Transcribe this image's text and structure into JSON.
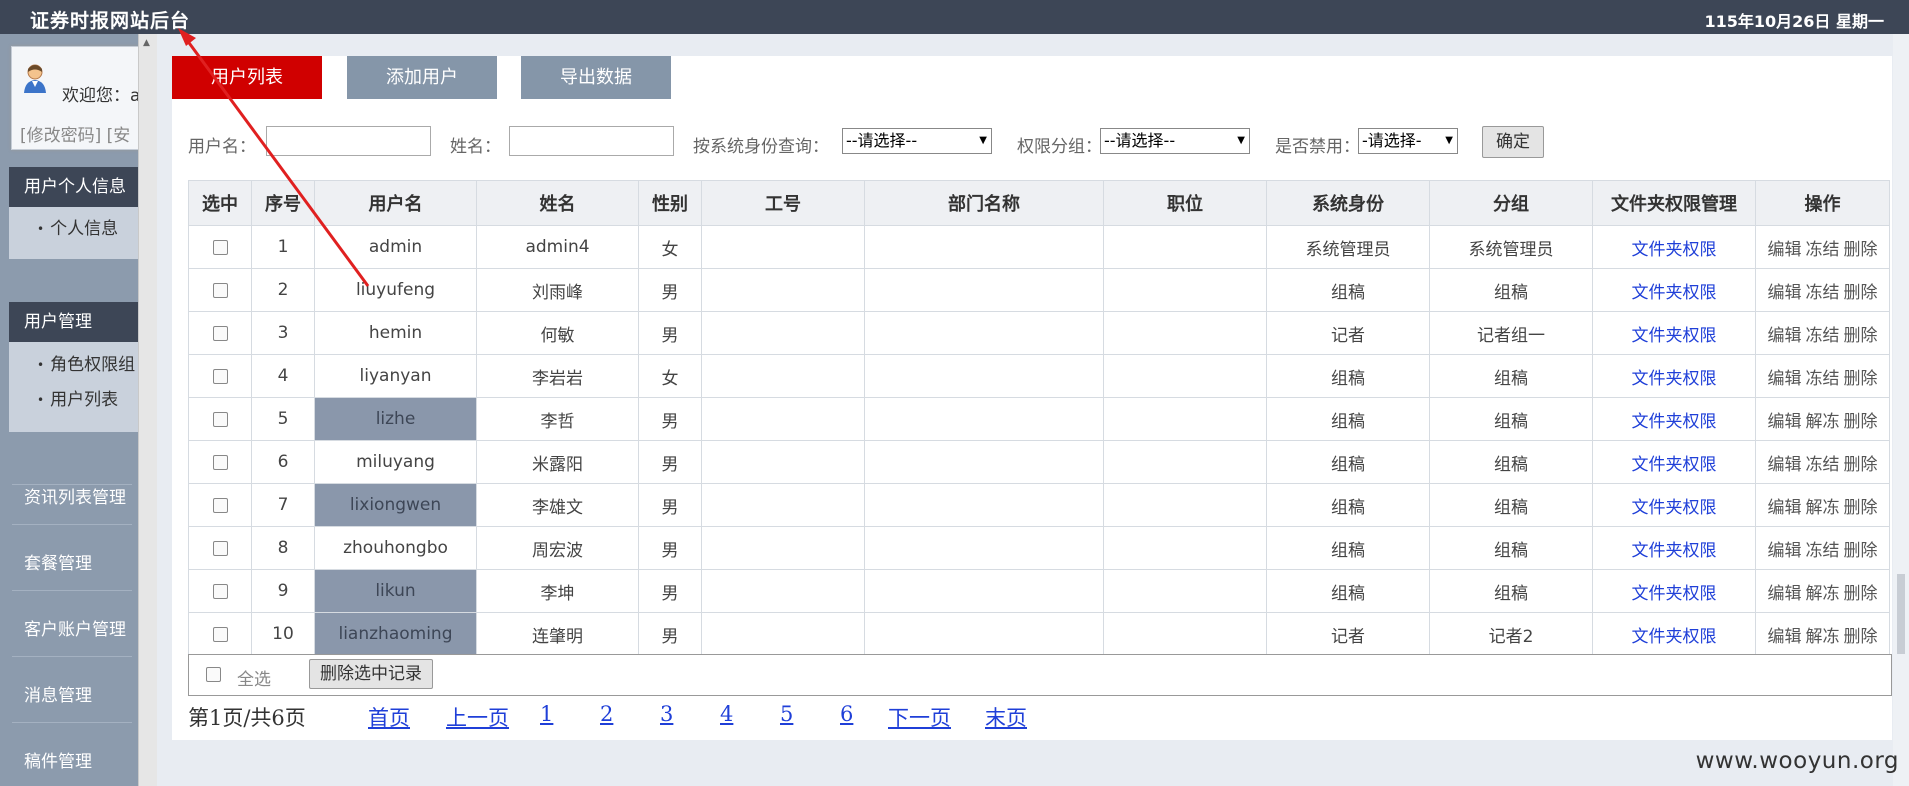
{
  "header": {
    "title": "证券时报网站后台",
    "date": "115年10月26日 星期一"
  },
  "sidebar": {
    "welcome": "欢迎您：a",
    "links": "[修改密码]  [安",
    "sections": [
      {
        "title": "用户个人信息",
        "items": [
          "个人信息"
        ]
      },
      {
        "title": "用户管理",
        "items": [
          "角色权限组",
          "用户列表"
        ]
      }
    ],
    "menu": [
      "资讯列表管理",
      "套餐管理",
      "客户账户管理",
      "消息管理",
      "稿件管理"
    ]
  },
  "tabs": [
    "用户列表",
    "添加用户",
    "导出数据"
  ],
  "filters": {
    "username_label": "用户名：",
    "name_label": "姓名：",
    "role_label": "按系统身份查询：",
    "role_value": "--请选择--",
    "group_label": "权限分组：",
    "group_value": "--请选择--",
    "disabled_label": "是否禁用：",
    "disabled_value": "-请选择-",
    "confirm": "确定"
  },
  "table": {
    "columns": [
      "选中",
      "序号",
      "用户名",
      "姓名",
      "性别",
      "工号",
      "部门名称",
      "职位",
      "系统身份",
      "分组",
      "文件夹权限管理",
      "操作"
    ],
    "rows": [
      {
        "no": "1",
        "username": "admin",
        "name": "admin4",
        "gender": "女",
        "role": "系统管理员",
        "group": "系统管理员",
        "perm": "文件夹权限",
        "edit": "编辑",
        "freeze": "冻结",
        "del": "删除",
        "hl": false
      },
      {
        "no": "2",
        "username": "liuyufeng",
        "name": "刘雨峰",
        "gender": "男",
        "role": "组稿",
        "group": "组稿",
        "perm": "文件夹权限",
        "edit": "编辑",
        "freeze": "冻结",
        "del": "删除",
        "hl": false
      },
      {
        "no": "3",
        "username": "hemin",
        "name": "何敏",
        "gender": "男",
        "role": "记者",
        "group": "记者组一",
        "perm": "文件夹权限",
        "edit": "编辑",
        "freeze": "冻结",
        "del": "删除",
        "hl": false
      },
      {
        "no": "4",
        "username": "liyanyan",
        "name": "李岩岩",
        "gender": "女",
        "role": "组稿",
        "group": "组稿",
        "perm": "文件夹权限",
        "edit": "编辑",
        "freeze": "冻结",
        "del": "删除",
        "hl": false
      },
      {
        "no": "5",
        "username": "lizhe",
        "name": "李哲",
        "gender": "男",
        "role": "组稿",
        "group": "组稿",
        "perm": "文件夹权限",
        "edit": "编辑",
        "freeze": "解冻",
        "del": "删除",
        "hl": true
      },
      {
        "no": "6",
        "username": "miluyang",
        "name": "米露阳",
        "gender": "男",
        "role": "组稿",
        "group": "组稿",
        "perm": "文件夹权限",
        "edit": "编辑",
        "freeze": "冻结",
        "del": "删除",
        "hl": false
      },
      {
        "no": "7",
        "username": "lixiongwen",
        "name": "李雄文",
        "gender": "男",
        "role": "组稿",
        "group": "组稿",
        "perm": "文件夹权限",
        "edit": "编辑",
        "freeze": "解冻",
        "del": "删除",
        "hl": true
      },
      {
        "no": "8",
        "username": "zhouhongbo",
        "name": "周宏波",
        "gender": "男",
        "role": "组稿",
        "group": "组稿",
        "perm": "文件夹权限",
        "edit": "编辑",
        "freeze": "冻结",
        "del": "删除",
        "hl": false
      },
      {
        "no": "9",
        "username": "likun",
        "name": "李坤",
        "gender": "男",
        "role": "组稿",
        "group": "组稿",
        "perm": "文件夹权限",
        "edit": "编辑",
        "freeze": "解冻",
        "del": "删除",
        "hl": true
      },
      {
        "no": "10",
        "username": "lianzhaoming",
        "name": "连肇明",
        "gender": "男",
        "role": "记者",
        "group": "记者2",
        "perm": "文件夹权限",
        "edit": "编辑",
        "freeze": "解冻",
        "del": "删除",
        "hl": true
      }
    ]
  },
  "footer": {
    "select_all": "全选",
    "delete_selected": "删除选中记录"
  },
  "pager": {
    "info": "第1页/共6页",
    "first": "首页",
    "prev": "上一页",
    "pages": [
      "1",
      "2",
      "3",
      "4",
      "5",
      "6"
    ],
    "next": "下一页",
    "last": "末页"
  },
  "watermark": "www.wooyun.org",
  "colors": {
    "topbar": "#3d4656",
    "sidebar": "#8c9bad",
    "active_tab": "#d00000",
    "inactive_tab": "#8596a9",
    "link": "#1f3fd8",
    "highlight_cell": "#8a97ab",
    "annotation": "#e02020"
  }
}
